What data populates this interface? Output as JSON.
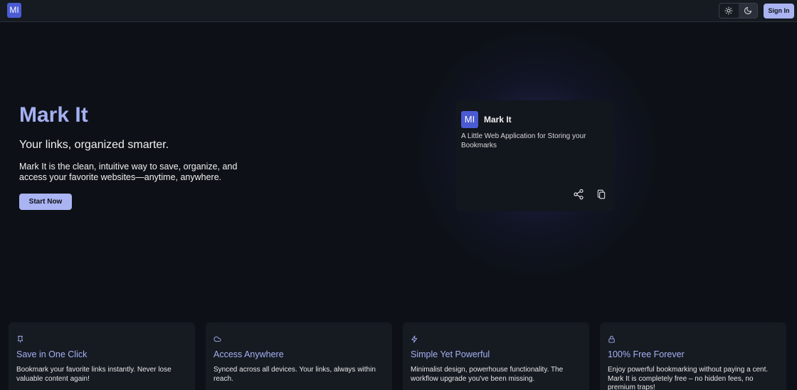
{
  "header": {
    "logo_text": "MI",
    "signin_label": "Sign In",
    "theme_options": [
      "light",
      "dark"
    ],
    "active_theme": "dark"
  },
  "hero": {
    "title": "Mark It",
    "subtitle": "Your links, organized smarter.",
    "description": "Mark It is the clean, intuitive way to save, organize, and access your favorite websites—anytime, anywhere.",
    "cta_label": "Start Now"
  },
  "preview_card": {
    "logo_text": "MI",
    "name": "Mark It",
    "description": "A Little Web Application for Storing your Bookmarks",
    "actions": [
      "share-icon",
      "copy-icon"
    ]
  },
  "features": [
    {
      "icon": "pin-icon",
      "title": "Save in One Click",
      "description": "Bookmark your favorite links instantly. Never lose valuable content again!"
    },
    {
      "icon": "cloud-icon",
      "title": "Access Anywhere",
      "description": "Synced across all devices. Your links, always within reach."
    },
    {
      "icon": "lightning-icon",
      "title": "Simple Yet Powerful",
      "description": "Minimalist design, powerhouse functionality. The workflow upgrade you've been missing."
    },
    {
      "icon": "lock-icon",
      "title": "100% Free Forever",
      "description": "Enjoy powerful bookmarking without paying a cent. Mark It is completely free – no hidden fees, no premium traps!"
    }
  ],
  "colors": {
    "background": "#0d1117",
    "accent": "#a5b0f2",
    "logo": "#4a5bd4",
    "card": "#161b22"
  }
}
